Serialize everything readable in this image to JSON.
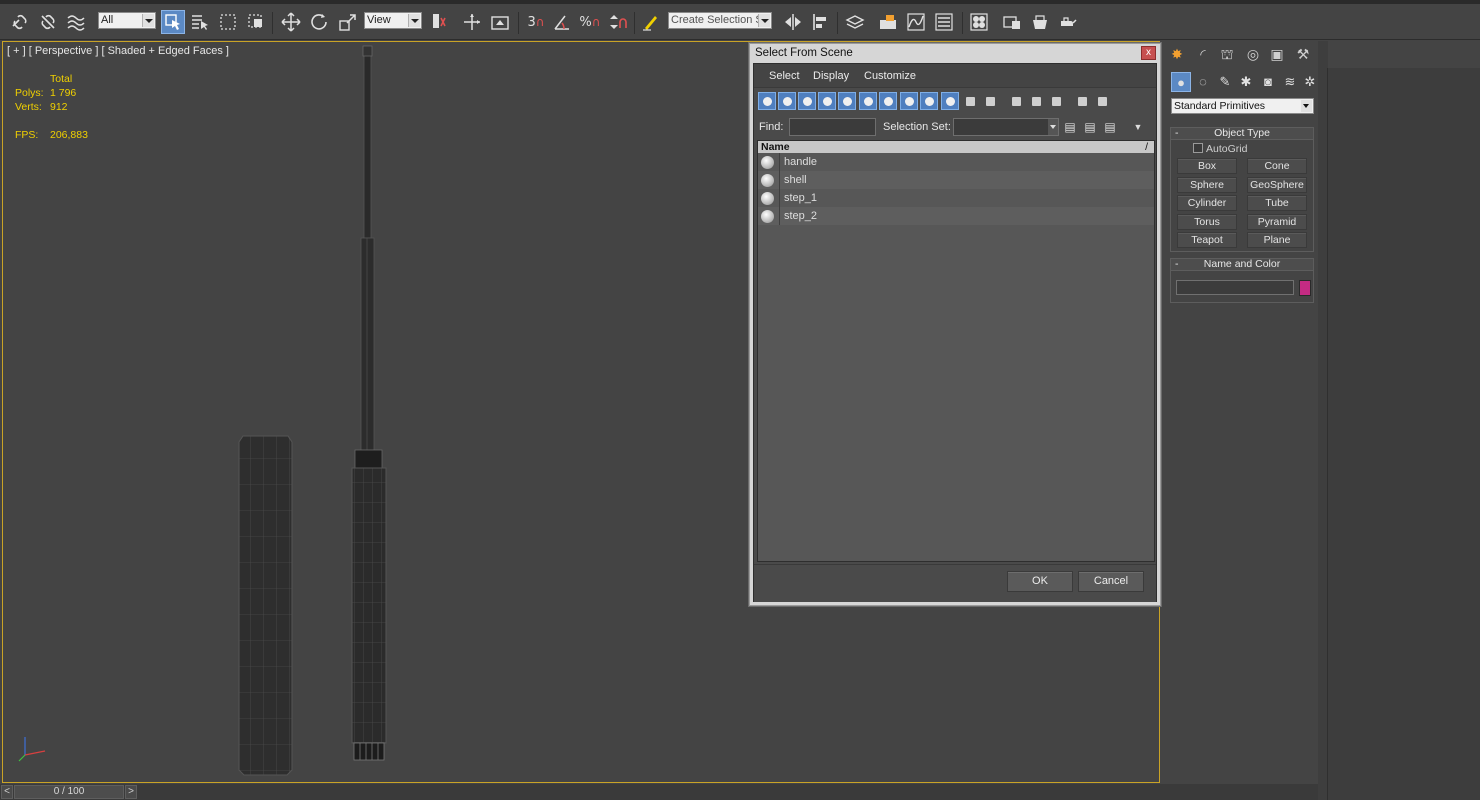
{
  "toolbar": {
    "selection_filter": "All",
    "reference_coord": "View",
    "named_selection": "Create Selection Se",
    "snap_3": "3",
    "percent_snap": "%"
  },
  "viewport": {
    "label": "[ + ] [ Perspective ] [ Shaded + Edged Faces ]",
    "stats": {
      "total_label": "Total",
      "polys_label": "Polys:",
      "polys_value": "1 796",
      "verts_label": "Verts:",
      "verts_value": "912",
      "fps_label": "FPS:",
      "fps_value": "206,883"
    }
  },
  "timeline": {
    "frame": "0 / 100",
    "prev": "<",
    "next": ">"
  },
  "dialog": {
    "title": "Select From Scene",
    "close": "x",
    "menu": [
      "Select",
      "Display",
      "Customize"
    ],
    "find_label": "Find:",
    "find_value": "",
    "selection_set_label": "Selection Set:",
    "list_header": "Name",
    "list_header_sort": "/",
    "objects": [
      "handle",
      "shell",
      "step_1",
      "step_2"
    ],
    "ok": "OK",
    "cancel": "Cancel"
  },
  "command_panel": {
    "category": "Standard Primitives",
    "object_type_title": "Object Type",
    "autogrid": "AutoGrid",
    "primitives": [
      "Box",
      "Cone",
      "Sphere",
      "GeoSphere",
      "Cylinder",
      "Tube",
      "Torus",
      "Pyramid",
      "Teapot",
      "Plane"
    ],
    "name_and_color_title": "Name and Color",
    "rollout_minus": "-",
    "name_value": "",
    "object_color": "#c42b83"
  },
  "colors": {
    "viewport_border": "#c9a326",
    "stats_text": "#f0d000",
    "active_blue": "#5b89c4"
  }
}
